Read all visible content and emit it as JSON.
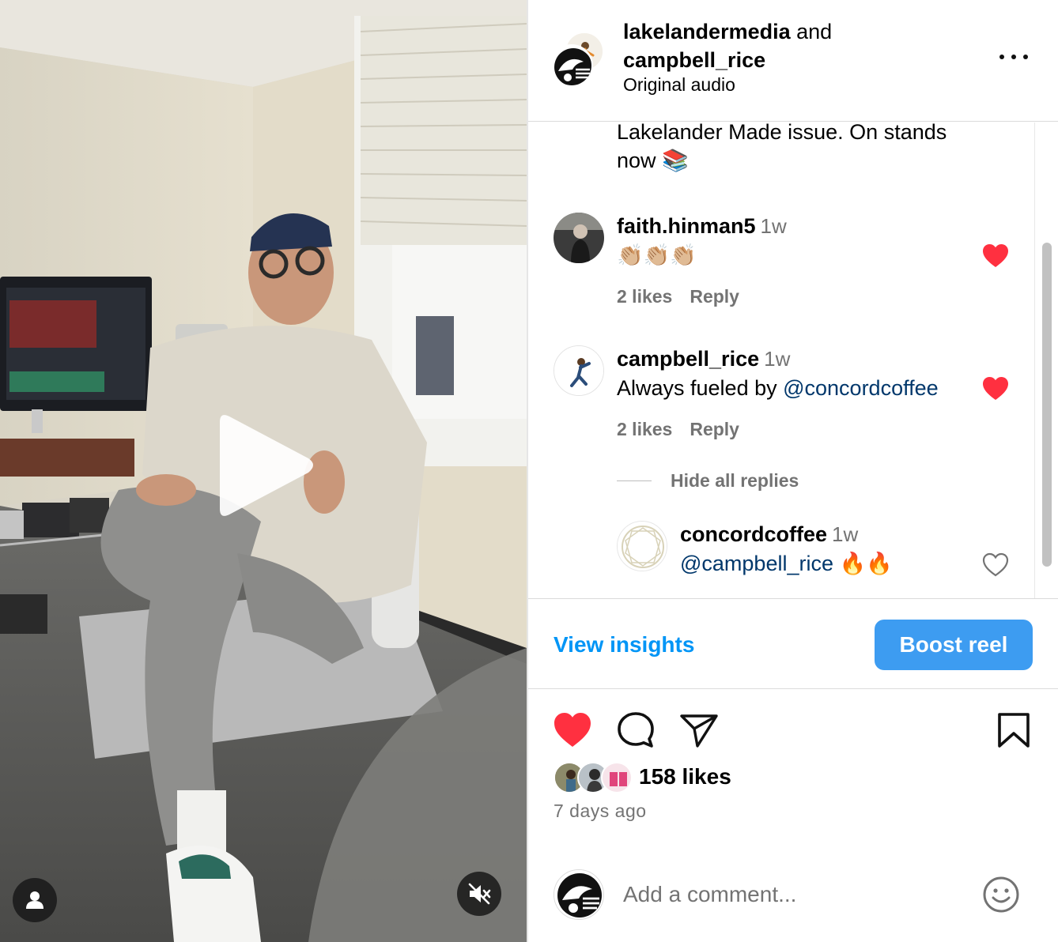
{
  "post": {
    "author": "lakelandermedia",
    "connector": "and",
    "collaborator": "campbell_rice",
    "audio": "Original audio",
    "more_icon": "more-horizontal-icon"
  },
  "caption_tail": "Lakelander Made issue. On stands now 📚",
  "comments": [
    {
      "user": "faith.hinman5",
      "time": "1w",
      "text": "👏🏼👏🏼👏🏼",
      "likes": "2 likes",
      "reply": "Reply",
      "liked": true
    },
    {
      "user": "campbell_rice",
      "time": "1w",
      "text_prefix": "Always fueled by ",
      "mention": "@concordcoffee",
      "likes": "2 likes",
      "reply": "Reply",
      "liked": true
    }
  ],
  "hide_replies": "Hide all replies",
  "reply": {
    "user": "concordcoffee",
    "time": "1w",
    "mention": "@campbell_rice",
    "text_suffix": " 🔥🔥",
    "liked": false
  },
  "insights": {
    "view_label": "View insights",
    "boost_label": "Boost reel"
  },
  "actions": {
    "like_icon": "heart-filled-icon",
    "comment_icon": "comment-icon",
    "share_icon": "send-icon",
    "save_icon": "bookmark-icon"
  },
  "likes_count": "158 likes",
  "post_time": "7 days ago",
  "add_comment": {
    "placeholder": "Add a comment...",
    "emoji_icon": "emoji-icon"
  },
  "colors": {
    "accent": "#0095f6",
    "boost": "#3d9cf1",
    "heart": "#ff3040",
    "mention": "#00376b",
    "muted": "#737373"
  }
}
